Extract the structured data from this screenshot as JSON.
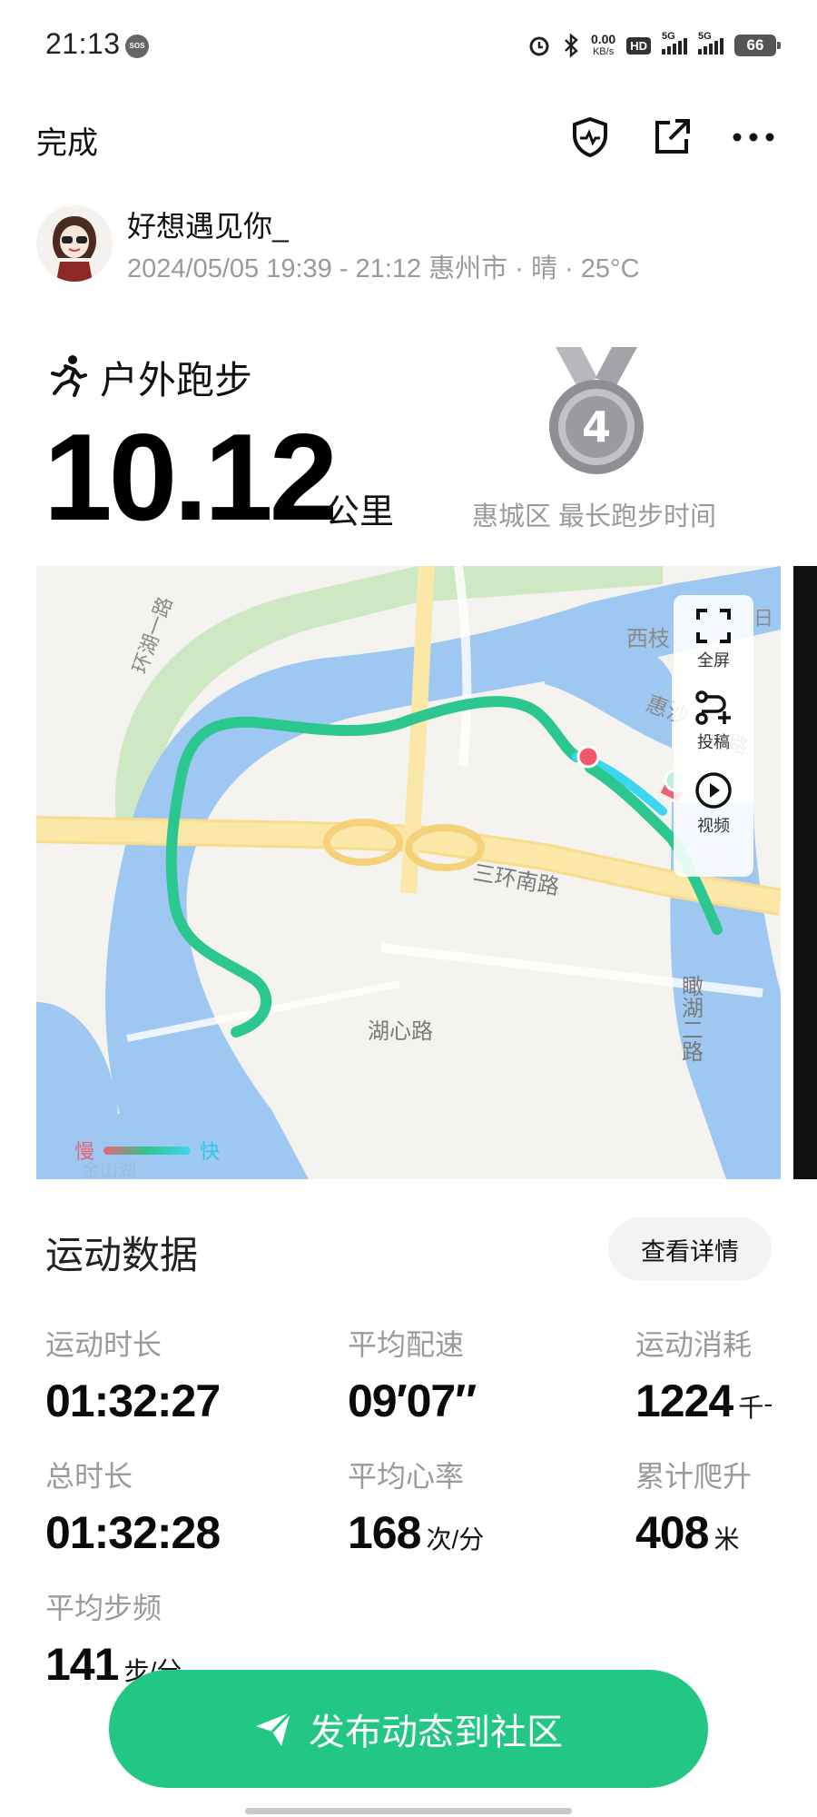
{
  "status_bar": {
    "time": "21:13",
    "sos": "SOS",
    "net_speed_value": "0.00",
    "net_speed_unit": "KB/s",
    "hd_label": "HD",
    "sim1_label": "5G",
    "sim2_label": "5G",
    "battery": "66"
  },
  "toolbar": {
    "done_label": "完成",
    "icons": [
      "shield-heart-icon",
      "share-icon",
      "more-icon"
    ]
  },
  "user": {
    "name": "好想遇见你_",
    "meta": "2024/05/05 19:39 - 21:12 惠州市 · 晴 · 25°C"
  },
  "activity": {
    "type_label": "户外跑步",
    "distance": "10.12",
    "distance_unit": "公里",
    "medal_number": "4",
    "medal_label": "惠城区 最长跑步时间"
  },
  "map": {
    "labels": {
      "road_huanhu": "环湖一路",
      "area_xizhi": "西枝",
      "road_huisha": "惠沙",
      "road_huisha_2": "路",
      "road_sanhuan": "三环南路",
      "road_huxin": "湖心路",
      "road_kanhu": "瞰湖二路",
      "area_ri": "日",
      "area_jinshan": "金山湖"
    },
    "tools": {
      "fullscreen": "全屏",
      "submit": "投稿",
      "video": "视频"
    },
    "legend_slow": "慢",
    "legend_fast": "快",
    "colors": {
      "water": "#9ec8f2",
      "park": "#cfe8c4",
      "route_fast": "#2cc790",
      "route_slow": "#e86474",
      "route_cyan": "#3dd6ee"
    }
  },
  "stats": {
    "title": "运动数据",
    "detail_button": "查看详情",
    "items": [
      {
        "label": "运动时长",
        "value": "01:32:27",
        "unit": ""
      },
      {
        "label": "平均配速",
        "value": "09′07″",
        "unit": ""
      },
      {
        "label": "运动消耗",
        "value": "1224",
        "unit": "千卡"
      },
      {
        "label": "总时长",
        "value": "01:32:28",
        "unit": ""
      },
      {
        "label": "平均心率",
        "value": "168",
        "unit": "次/分"
      },
      {
        "label": "累计爬升",
        "value": "408",
        "unit": "米"
      },
      {
        "label": "平均步频",
        "value": "141",
        "unit": "步/分"
      }
    ]
  },
  "publish": {
    "label": "发布动态到社区"
  },
  "theme": {
    "accent": "#22c784"
  }
}
